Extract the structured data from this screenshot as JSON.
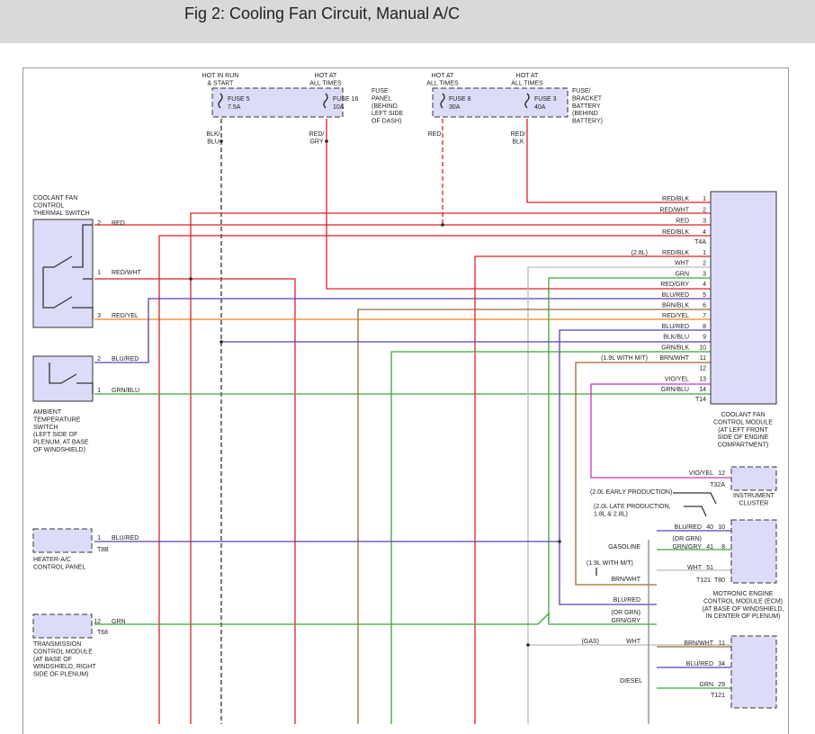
{
  "page": {
    "title": "Fig 2: Cooling Fan Circuit, Manual A/C"
  },
  "fuses": {
    "f5": {
      "hot": [
        "HOT IN RUN",
        "& START"
      ],
      "name": "FUSE 5",
      "rating": "7.5A",
      "wire": [
        "BLK/",
        "BLU"
      ]
    },
    "f16": {
      "hot": [
        "HOT AT",
        "ALL TIMES"
      ],
      "name": "FUSE 16",
      "rating": "10A",
      "wire": [
        "RED/",
        "GRY"
      ]
    },
    "panel_label": [
      "FUSE",
      "PANEL",
      "(BEHIND",
      "LEFT SIDE",
      "OF DASH)"
    ],
    "f8": {
      "hot": [
        "HOT AT",
        "ALL TIMES"
      ],
      "name": "FUSE 8",
      "rating": "30A",
      "wire": [
        "RED"
      ]
    },
    "f3": {
      "hot": [
        "HOT AT",
        "ALL TIMES"
      ],
      "name": "FUSE 3",
      "rating": "40A",
      "wire": [
        "RED/",
        "BLK"
      ]
    },
    "bracket_label": [
      "FUSE/",
      "BRACKET",
      "BATTERY",
      "(BEHIND",
      "BATTERY)"
    ]
  },
  "components": {
    "thermal_switch": [
      "COOLANT FAN",
      "CONTROL",
      "THERMAL SWITCH"
    ],
    "ambient_switch": [
      "AMBIENT",
      "TEMPERATURE",
      "SWITCH",
      "(LEFT SIDE OF",
      "PLENUM, AT BASE",
      "OF WINDSHIELD)"
    ],
    "fan_module": [
      "COOLANT FAN",
      "CONTROL MODULE",
      "(AT LEFT FRONT",
      "SIDE OF ENGINE",
      "COMPARTMENT)"
    ],
    "cluster": [
      "INSTRUMENT",
      "CLUSTER"
    ],
    "heater": [
      "HEATER-A/C",
      "CONTROL PANEL"
    ],
    "tcm": [
      "TRANSMISSION",
      "CONTROL MODULE",
      "(AT BASE OF",
      "WINDSHIELD, RIGHT",
      "SIDE OF PLENUM)"
    ],
    "ecm": [
      "MOTRONIC ENGINE",
      "CONTROL MODULE (ECM)",
      "(AT BASE OF WINDSHIELD,",
      "IN CENTER OF PLENUM)"
    ]
  },
  "left_pins": {
    "ts1": {
      "pin": "2",
      "wire": "RED"
    },
    "ts2": {
      "pin": "1",
      "wire": "RED/WHT"
    },
    "ts3": {
      "pin": "3",
      "wire": "RED/YEL"
    },
    "as1": {
      "pin": "2",
      "wire": "BLU/RED"
    },
    "as2": {
      "pin": "1",
      "wire": "GRN/BLU"
    },
    "hv": {
      "pin": "1",
      "wire": "BLU/RED",
      "conn": "T8B"
    },
    "tc": {
      "pin": "12",
      "wire": "GRN",
      "conn": "T68"
    }
  },
  "t4a": {
    "connector": "T4A",
    "rows": [
      {
        "wire": "RED/BLK",
        "pin": "1"
      },
      {
        "wire": "RED/WHT",
        "pin": "2"
      },
      {
        "wire": "RED",
        "pin": "3"
      },
      {
        "wire": "RED/BLK",
        "pin": "4"
      }
    ]
  },
  "t14": {
    "connector": "T14",
    "rows": [
      {
        "note": "(2.8L)",
        "wire": "RED/BLK",
        "pin": "1"
      },
      {
        "note": "",
        "wire": "WHT",
        "pin": "2"
      },
      {
        "note": "",
        "wire": "GRN",
        "pin": "3"
      },
      {
        "note": "",
        "wire": "RED/GRY",
        "pin": "4"
      },
      {
        "note": "",
        "wire": "BLU/RED",
        "pin": "5"
      },
      {
        "note": "",
        "wire": "BRN/BLK",
        "pin": "6"
      },
      {
        "note": "",
        "wire": "RED/YEL",
        "pin": "7"
      },
      {
        "note": "",
        "wire": "BLU/RED",
        "pin": "8"
      },
      {
        "note": "",
        "wire": "BLK/BLU",
        "pin": "9"
      },
      {
        "note": "",
        "wire": "GRN/BLK",
        "pin": "10"
      },
      {
        "note": "(1.9L WITH M/T)",
        "wire": "BRN/WHT",
        "pin": "11"
      },
      {
        "note": "",
        "wire": "",
        "pin": "12"
      },
      {
        "note": "",
        "wire": "VIO/YEL",
        "pin": "13"
      },
      {
        "note": "",
        "wire": "GRN/BLU",
        "pin": "14"
      }
    ]
  },
  "cluster_pin": {
    "wire": "VIO/YEL",
    "pin": "12",
    "conn": "T32A"
  },
  "ecm_notes": {
    "early": "(2.0L EARLY PRODUCTION)",
    "late": [
      "(2.0L LATE PRODUCTION,",
      "1.8L & 2.8L)"
    ],
    "r1": {
      "wire": "BLU/RED",
      "p1": "40",
      "p2": "10"
    },
    "orgrn1": "(OR GRN)",
    "gasoline": "GASOLINE",
    "r2": {
      "wire": "GRN/GRY",
      "p1": "41",
      "p2": "8"
    },
    "r3": {
      "wire": "WHT",
      "p1": "51"
    },
    "t121": "T121",
    "t80": "T80",
    "mt_note": "(1.9L WITH M/T)",
    "brnwht": "BRN/WHT",
    "blured": "BLU/RED",
    "orgrn2": "(OR GRN)",
    "grngry": "GRN/GRY",
    "gas": "(GAS)",
    "wht": "WHT",
    "diesel": "DIESEL",
    "d1": {
      "wire": "BRN/WHT",
      "pin": "11"
    },
    "d2": {
      "wire": "BLU/RED",
      "pin": "34"
    },
    "d3": {
      "wire": "GRN",
      "pin": "29"
    },
    "dconn": "T121"
  },
  "colors": {
    "red": "#e02020",
    "purple": "#5a3db8",
    "green": "#3aa83a",
    "brown": "#9a6a30",
    "orange": "#f08020",
    "black": "#333333",
    "gray": "#bbbbbb",
    "magenta": "#d030c0",
    "box_fill": "#dcdcf8"
  }
}
